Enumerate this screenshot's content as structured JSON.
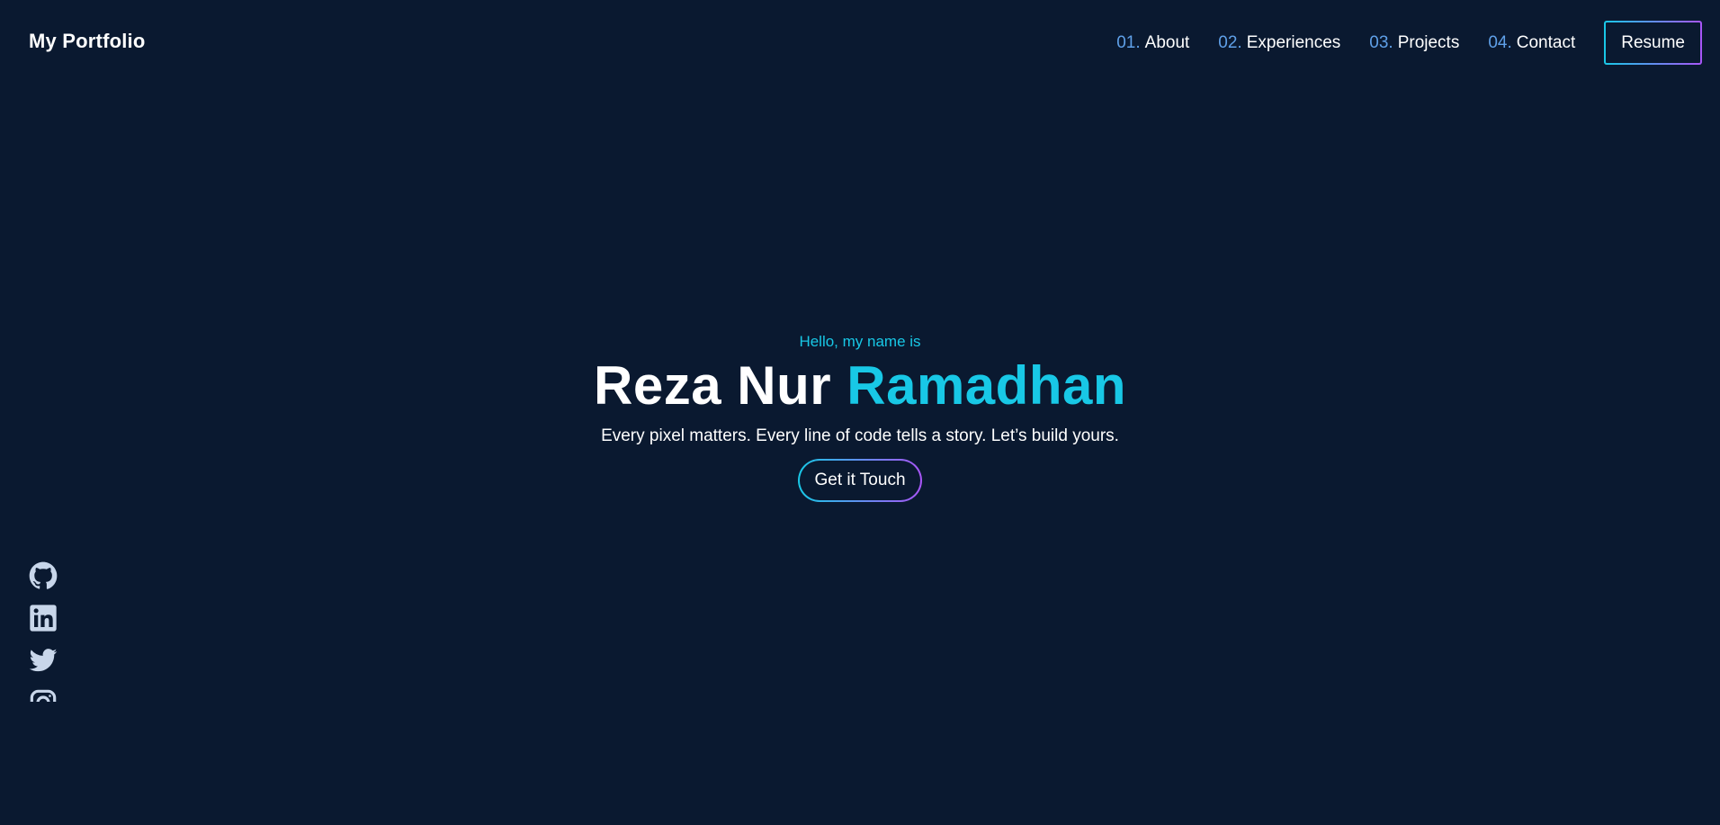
{
  "header": {
    "brand": "My Portfolio",
    "nav": [
      {
        "num": "01.",
        "label": "About"
      },
      {
        "num": "02.",
        "label": "Experiences"
      },
      {
        "num": "03.",
        "label": "Projects"
      },
      {
        "num": "04.",
        "label": "Contact"
      }
    ],
    "resume_label": "Resume"
  },
  "hero": {
    "greeting": "Hello, my name is",
    "name_first": "Reza Nur",
    "name_accent": "Ramadhan",
    "tagline": "Every pixel matters. Every line of code tells a story. Let’s build yours.",
    "cta_label": "Get it Touch"
  },
  "social": {
    "icons": [
      "github-icon",
      "linkedin-icon",
      "twitter-icon",
      "instagram-icon"
    ]
  },
  "colors": {
    "background": "#0a1930",
    "accent_cyan": "#18c8e6",
    "accent_purple": "#a855f7",
    "nav_number": "#5fa0e8",
    "icon": "#c8d6ea"
  }
}
